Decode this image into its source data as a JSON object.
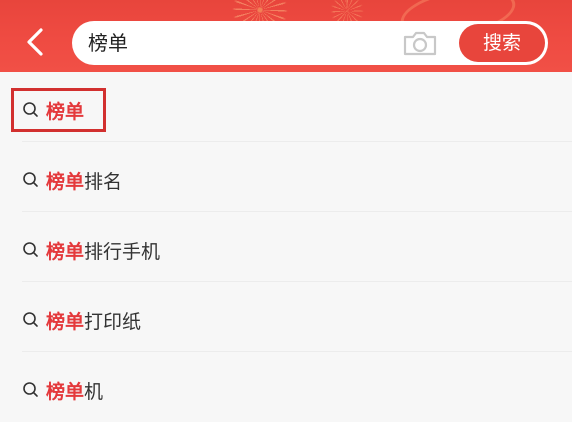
{
  "header": {
    "query": "榜单",
    "search_button": "搜索"
  },
  "suggestions": [
    {
      "keyword": "榜单",
      "suffix": ""
    },
    {
      "keyword": "榜单",
      "suffix": "排名"
    },
    {
      "keyword": "榜单",
      "suffix": "排行手机"
    },
    {
      "keyword": "榜单",
      "suffix": "打印纸"
    },
    {
      "keyword": "榜单",
      "suffix": "机"
    }
  ],
  "colors": {
    "brand_red": "#e8453c",
    "keyword_red": "#e4393c",
    "highlight_border": "#d2302f"
  },
  "icons": [
    "back-arrow-icon",
    "camera-icon",
    "search-icon"
  ]
}
